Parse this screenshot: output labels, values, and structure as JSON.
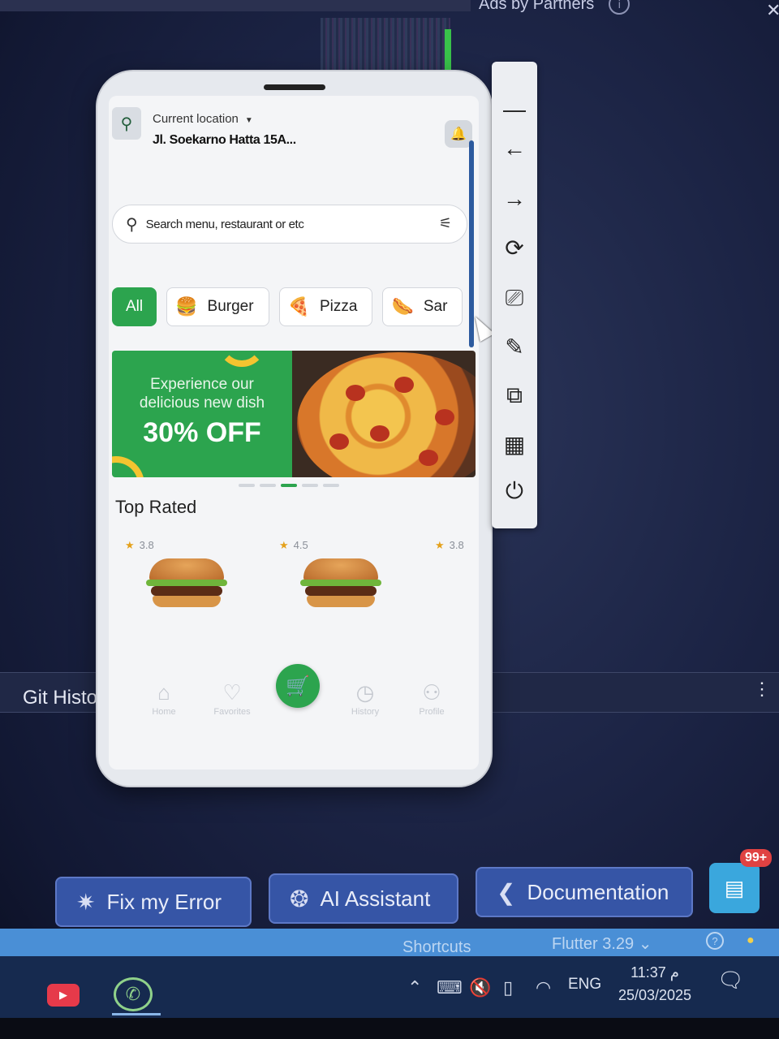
{
  "top_bar": {
    "ads_label": "Ads by Partners",
    "info_icon": "info-icon",
    "close_icon": "close-icon"
  },
  "ide": {
    "git_history_label": "Git Histor",
    "more_icon": "kebab-menu-icon"
  },
  "app": {
    "location": {
      "label": "Current location",
      "address": "Jl. Soekarno Hatta 15A..."
    },
    "search": {
      "placeholder": "Search menu, restaurant or etc"
    },
    "categories": [
      {
        "label": "All",
        "active": true
      },
      {
        "label": "Burger",
        "icon": "burger-icon"
      },
      {
        "label": "Pizza",
        "icon": "pizza-icon"
      },
      {
        "label": "Sar",
        "icon": "hotdog-icon"
      }
    ],
    "banner": {
      "line1": "Experience our",
      "line2": "delicious new dish",
      "offer": "30% OFF",
      "slide_index": 3,
      "slide_count": 5
    },
    "top_rated": {
      "title": "Top Rated",
      "items": [
        {
          "rating": "3.8"
        },
        {
          "rating": "4.5"
        },
        {
          "rating": "3.8"
        }
      ]
    },
    "bottom_nav": [
      {
        "label": "Home",
        "icon": "home-icon"
      },
      {
        "label": "Favorites",
        "icon": "heart-icon"
      },
      {
        "label": "",
        "icon": "cart-icon"
      },
      {
        "label": "History",
        "icon": "clock-icon"
      },
      {
        "label": "Profile",
        "icon": "user-icon"
      }
    ],
    "accent_color": "#2ca44e"
  },
  "emulator_toolbar": [
    {
      "icon": "minimize-icon"
    },
    {
      "icon": "back-arrow-icon"
    },
    {
      "icon": "forward-arrow-icon"
    },
    {
      "icon": "rotate-icon"
    },
    {
      "icon": "rotate-device-icon"
    },
    {
      "icon": "edit-icon"
    },
    {
      "icon": "open-external-icon"
    },
    {
      "icon": "qr-code-icon"
    },
    {
      "icon": "power-icon"
    }
  ],
  "actions": {
    "fix_error": "Fix my Error",
    "ai_assistant": "AI Assistant",
    "documentation": "Documentation",
    "chat_badge": "99+"
  },
  "status_bar": {
    "shortcuts": "Shortcuts",
    "flutter": "Flutter 3.29"
  },
  "taskbar": {
    "language": "ENG",
    "time": "11:37 م",
    "date": "25/03/2025"
  }
}
